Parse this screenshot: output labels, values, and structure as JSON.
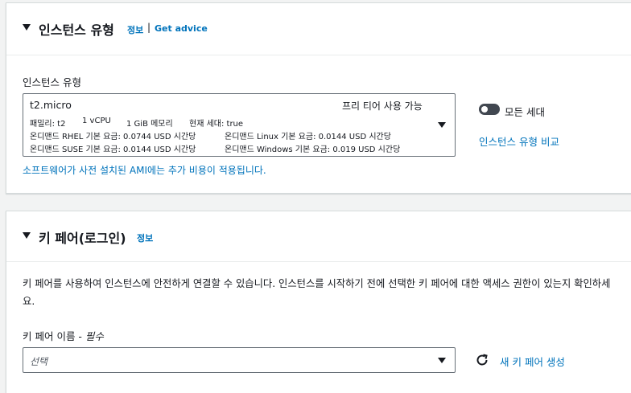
{
  "instance_type_section": {
    "title": "인스턴스 유형",
    "info_link": "정보",
    "divider": "|",
    "advice_link": "Get advice",
    "field_label": "인스턴스 유형",
    "selected": {
      "name": "t2.micro",
      "free_tier": "프리 티어 사용 가능",
      "specs": {
        "family": "패밀리: t2",
        "vcpu": "1 vCPU",
        "memory": "1 GiB 메모리",
        "current_gen": "현재 세대: true"
      },
      "pricing": {
        "rhel": "온디맨드 RHEL 기본 요금: 0.0744 USD 시간당",
        "linux": "온디맨드 Linux 기본 요금: 0.0144 USD 시간당",
        "suse": "온디맨드 SUSE 기본 요금: 0.0144 USD 시간당",
        "windows": "온디맨드 Windows 기본 요금: 0.019 USD 시간당"
      }
    },
    "all_generations_toggle": {
      "label": "모든 세대",
      "on": false
    },
    "compare_link": "인스턴스 유형 비교",
    "ami_note": "소프트웨어가 사전 설치된 AMI에는 추가 비용이 적용됩니다."
  },
  "key_pair_section": {
    "title": "키 페어(로그인)",
    "info_link": "정보",
    "description": "키 페어를 사용하여 인스턴스에 안전하게 연결할 수 있습니다. 인스턴스를 시작하기 전에 선택한 키 페어에 대한 액세스 권한이 있는지 확인하세요.",
    "field_label": "키 페어 이름 - ",
    "field_required": "필수",
    "select_placeholder": "선택",
    "create_link": "새 키 페어 생성"
  },
  "colors": {
    "link": "#0073bb",
    "text": "#16191f",
    "border": "#687078",
    "background": "#f2f3f3"
  },
  "icons": [
    "caret-down-icon",
    "dropdown-arrow-icon",
    "toggle-switch-icon",
    "refresh-icon"
  ]
}
